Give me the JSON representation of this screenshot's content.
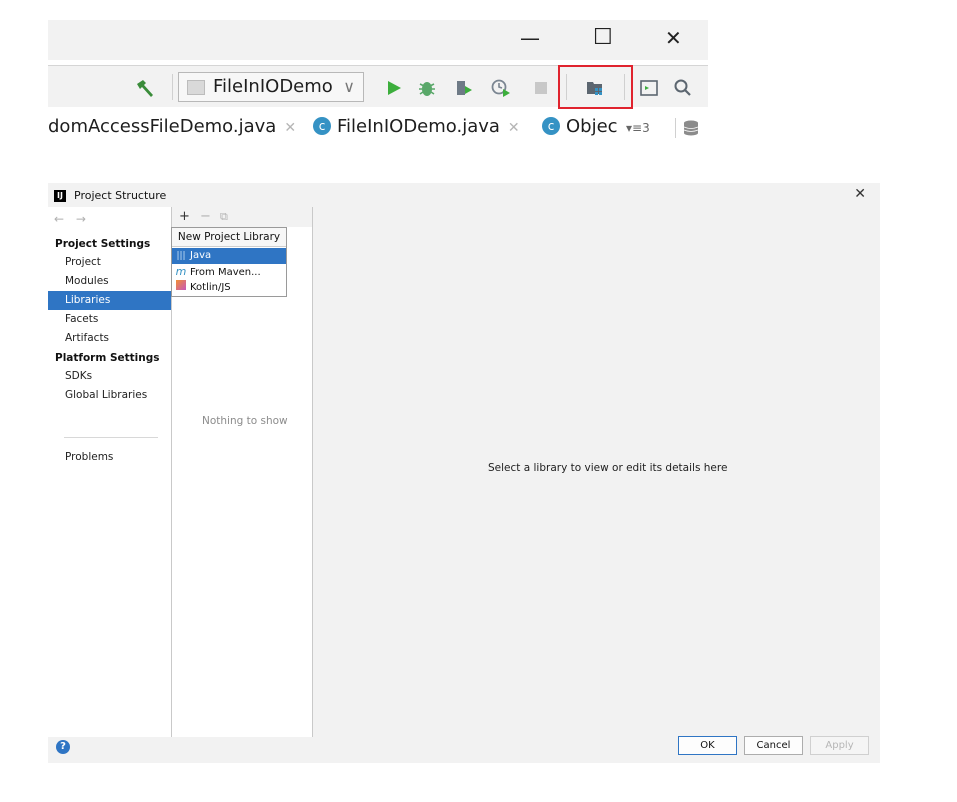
{
  "ide": {
    "window_controls": {
      "minimize": "—",
      "maximize": "☐",
      "close": "✕"
    },
    "run_config": {
      "label": "FileInIODemo",
      "chevron": "∨"
    },
    "tabs": [
      {
        "label": "domAccessFileDemo.java",
        "close": "✕"
      },
      {
        "label": "FileInIODemo.java",
        "close": "✕"
      },
      {
        "label": "Objec",
        "close": ""
      }
    ],
    "tab_overflow": "▾≡3",
    "toolbar_icons": [
      "hammer-icon",
      "run-icon",
      "debug-icon",
      "coverage-icon",
      "profile-icon",
      "stop-icon",
      "project-structure-icon",
      "terminal-icon",
      "search-icon",
      "database-icon"
    ],
    "highlight_color": "#e0232e"
  },
  "dialog": {
    "title": "Project Structure",
    "close": "✕",
    "nav": {
      "back": "←",
      "forward": "→"
    },
    "sections": {
      "project_settings": "Project Settings",
      "platform_settings": "Platform Settings"
    },
    "items": {
      "project": "Project",
      "modules": "Modules",
      "libraries": "Libraries",
      "facets": "Facets",
      "artifacts": "Artifacts",
      "sdks": "SDKs",
      "global_libraries": "Global Libraries",
      "problems": "Problems"
    },
    "selected_item": "Libraries",
    "middle_toolbar": {
      "add": "+",
      "remove": "−",
      "copy": "⧉"
    },
    "empty_text": "Nothing to show",
    "detail_hint": "Select a library to view or edit its details here",
    "popup": {
      "header": "New Project Library",
      "items": [
        {
          "label": "Java",
          "icon": "library-icon"
        },
        {
          "label": "From Maven...",
          "icon": "maven-icon"
        },
        {
          "label": "Kotlin/JS",
          "icon": "kotlin-js-icon"
        }
      ],
      "selected": "Java"
    },
    "buttons": {
      "ok": "OK",
      "cancel": "Cancel",
      "apply": "Apply"
    },
    "help": "?",
    "accent": "#2f75c4"
  }
}
